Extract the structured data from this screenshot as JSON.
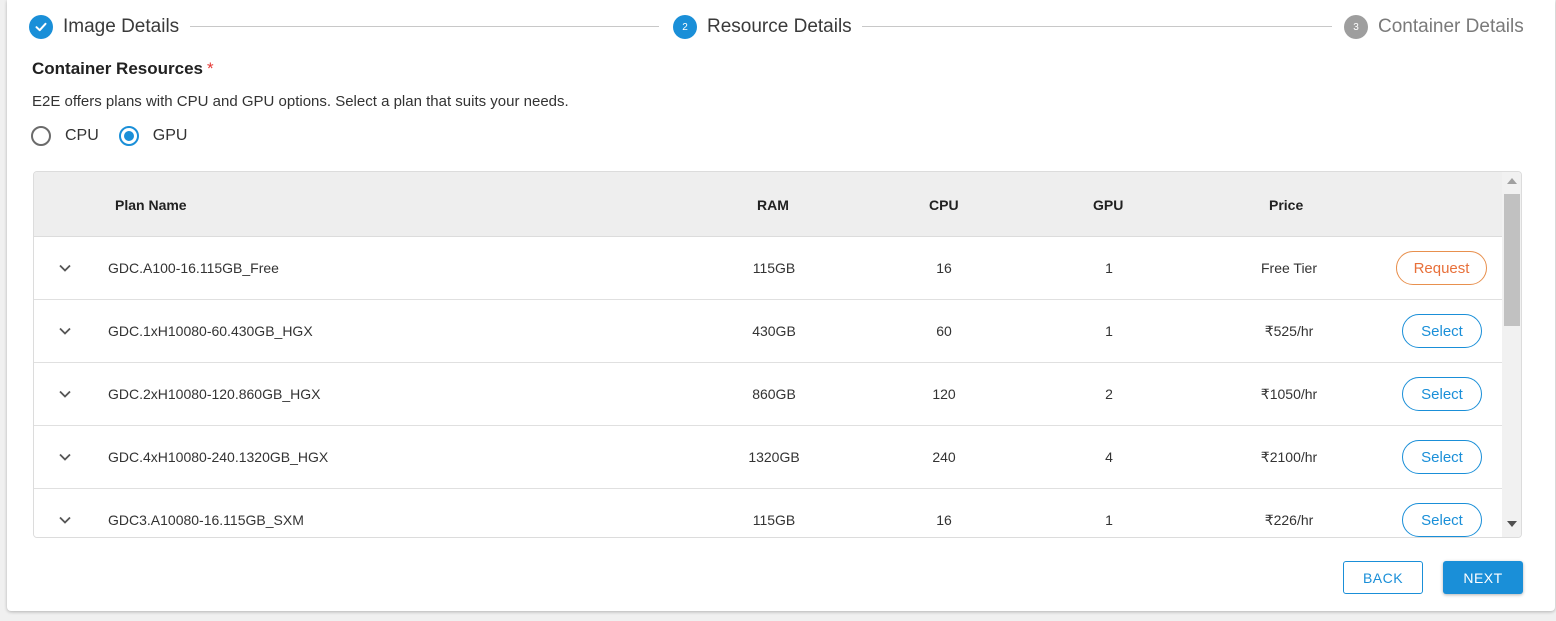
{
  "stepper": {
    "steps": [
      {
        "number": "1",
        "label": "Image Details",
        "state": "done"
      },
      {
        "number": "2",
        "label": "Resource Details",
        "state": "active"
      },
      {
        "number": "3",
        "label": "Container Details",
        "state": "pending"
      }
    ]
  },
  "section": {
    "title": "Container Resources",
    "required_mark": "*",
    "description": "E2E offers plans with CPU and GPU options. Select a plan that suits your needs."
  },
  "plan_type": {
    "options": [
      {
        "label": "CPU",
        "checked": false
      },
      {
        "label": "GPU",
        "checked": true
      }
    ]
  },
  "table": {
    "headers": {
      "plan_name": "Plan Name",
      "ram": "RAM",
      "cpu": "CPU",
      "gpu": "GPU",
      "price": "Price"
    },
    "rows": [
      {
        "plan_name": "GDC.A100-16.115GB_Free",
        "ram": "115GB",
        "cpu": "16",
        "gpu": "1",
        "price": "Free Tier",
        "action": "Request",
        "action_type": "request"
      },
      {
        "plan_name": "GDC.1xH10080-60.430GB_HGX",
        "ram": "430GB",
        "cpu": "60",
        "gpu": "1",
        "price": "₹525/hr",
        "action": "Select",
        "action_type": "select"
      },
      {
        "plan_name": "GDC.2xH10080-120.860GB_HGX",
        "ram": "860GB",
        "cpu": "120",
        "gpu": "2",
        "price": "₹1050/hr",
        "action": "Select",
        "action_type": "select"
      },
      {
        "plan_name": "GDC.4xH10080-240.1320GB_HGX",
        "ram": "1320GB",
        "cpu": "240",
        "gpu": "4",
        "price": "₹2100/hr",
        "action": "Select",
        "action_type": "select"
      },
      {
        "plan_name": "GDC3.A10080-16.115GB_SXM",
        "ram": "115GB",
        "cpu": "16",
        "gpu": "1",
        "price": "₹226/hr",
        "action": "Select",
        "action_type": "select"
      }
    ]
  },
  "footer": {
    "back_label": "BACK",
    "next_label": "NEXT"
  },
  "colors": {
    "primary": "#1a8fd8",
    "request": "#e8703a",
    "required": "#e53935"
  }
}
